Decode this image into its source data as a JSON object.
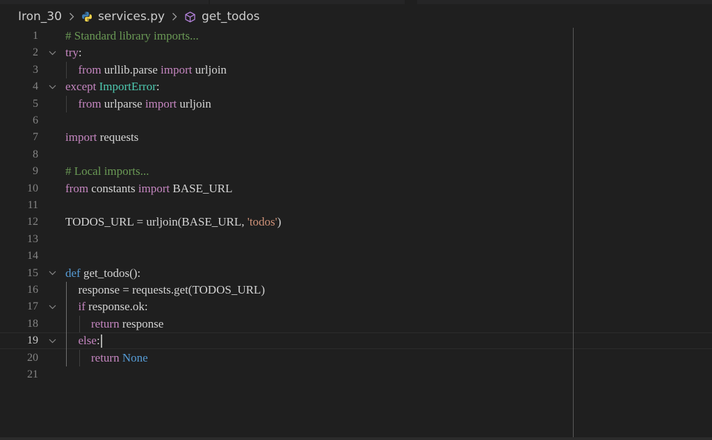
{
  "breadcrumb": {
    "folder": "Iron_30",
    "file": "services.py",
    "symbol": "get_todos"
  },
  "icons": {
    "separator": "chevron-right-icon",
    "file": "python-file-icon",
    "symbol": "method-cube-icon",
    "fold": "chevron-down-icon"
  },
  "editor": {
    "active_line": 19,
    "line_numbers": [
      "1",
      "2",
      "3",
      "4",
      "5",
      "6",
      "7",
      "8",
      "9",
      "10",
      "11",
      "12",
      "13",
      "14",
      "15",
      "16",
      "17",
      "18",
      "19",
      "20",
      "21"
    ],
    "lines": [
      {
        "n": 1,
        "indent": 0,
        "tokens": [
          {
            "t": "# Standard library imports...",
            "c": "cm"
          }
        ]
      },
      {
        "n": 2,
        "indent": 0,
        "tokens": [
          {
            "t": "try",
            "c": "kw"
          },
          {
            "t": ":",
            "c": ""
          }
        ]
      },
      {
        "n": 3,
        "indent": 1,
        "tokens": [
          {
            "t": "from",
            "c": "kw"
          },
          {
            "t": " urllib.parse ",
            "c": ""
          },
          {
            "t": "import",
            "c": "kw"
          },
          {
            "t": " urljoin",
            "c": ""
          }
        ]
      },
      {
        "n": 4,
        "indent": 0,
        "tokens": [
          {
            "t": "except",
            "c": "kw"
          },
          {
            "t": " ",
            "c": ""
          },
          {
            "t": "ImportError",
            "c": "cls"
          },
          {
            "t": ":",
            "c": ""
          }
        ]
      },
      {
        "n": 5,
        "indent": 1,
        "tokens": [
          {
            "t": "from",
            "c": "kw"
          },
          {
            "t": " urlparse ",
            "c": ""
          },
          {
            "t": "import",
            "c": "kw"
          },
          {
            "t": " urljoin",
            "c": ""
          }
        ]
      },
      {
        "n": 6,
        "indent": 0,
        "tokens": []
      },
      {
        "n": 7,
        "indent": 0,
        "tokens": [
          {
            "t": "import",
            "c": "kw"
          },
          {
            "t": " requests",
            "c": ""
          }
        ]
      },
      {
        "n": 8,
        "indent": 0,
        "tokens": []
      },
      {
        "n": 9,
        "indent": 0,
        "tokens": [
          {
            "t": "# Local imports...",
            "c": "cm"
          }
        ]
      },
      {
        "n": 10,
        "indent": 0,
        "tokens": [
          {
            "t": "from",
            "c": "kw"
          },
          {
            "t": " constants ",
            "c": ""
          },
          {
            "t": "import",
            "c": "kw"
          },
          {
            "t": " BASE_URL",
            "c": ""
          }
        ]
      },
      {
        "n": 11,
        "indent": 0,
        "tokens": []
      },
      {
        "n": 12,
        "indent": 0,
        "tokens": [
          {
            "t": "TODOS_URL = urljoin(BASE_URL, ",
            "c": ""
          },
          {
            "t": "'todos'",
            "c": "str"
          },
          {
            "t": ")",
            "c": ""
          }
        ]
      },
      {
        "n": 13,
        "indent": 0,
        "tokens": []
      },
      {
        "n": 14,
        "indent": 0,
        "tokens": []
      },
      {
        "n": 15,
        "indent": 0,
        "tokens": [
          {
            "t": "def",
            "c": "kwb"
          },
          {
            "t": " get_todos():",
            "c": ""
          }
        ]
      },
      {
        "n": 16,
        "indent": 1,
        "tokens": [
          {
            "t": "response = requests.get(TODOS_URL)",
            "c": ""
          }
        ]
      },
      {
        "n": 17,
        "indent": 1,
        "tokens": [
          {
            "t": "if",
            "c": "kw"
          },
          {
            "t": " response.ok:",
            "c": ""
          }
        ]
      },
      {
        "n": 18,
        "indent": 2,
        "tokens": [
          {
            "t": "return",
            "c": "kw"
          },
          {
            "t": " response",
            "c": ""
          }
        ]
      },
      {
        "n": 19,
        "indent": 1,
        "tokens": [
          {
            "t": "else",
            "c": "kw"
          },
          {
            "t": ":",
            "c": ""
          }
        ]
      },
      {
        "n": 20,
        "indent": 2,
        "tokens": [
          {
            "t": "return",
            "c": "kw"
          },
          {
            "t": " ",
            "c": ""
          },
          {
            "t": "None",
            "c": "kwb"
          }
        ]
      },
      {
        "n": 21,
        "indent": 0,
        "tokens": []
      }
    ],
    "fold_lines": [
      2,
      4,
      15,
      17,
      19
    ]
  },
  "colors": {
    "background": "#1f1f1f",
    "keyword": "#c586c0",
    "keyword_blue": "#569cd6",
    "comment": "#6a9955",
    "class": "#4ec9b0",
    "string": "#ce9178",
    "text": "#d4d4d4",
    "line_number": "#858585",
    "python_icon_blue": "#3e7cb1",
    "python_icon_yellow": "#f5d34b",
    "symbol_icon": "#b180d7"
  }
}
